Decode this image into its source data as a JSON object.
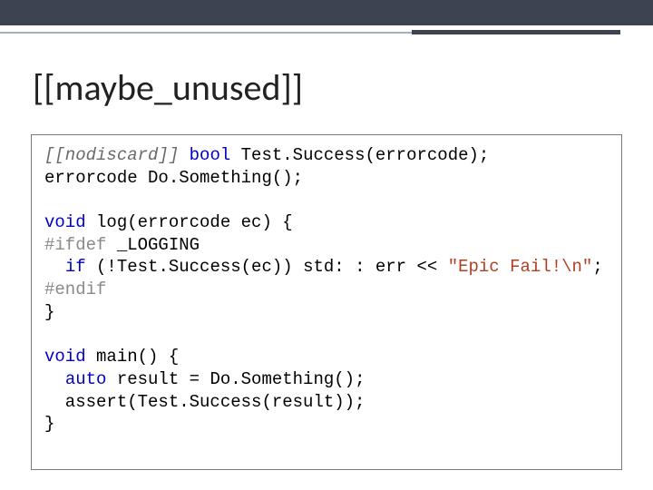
{
  "title": "[[maybe_unused]]",
  "code": {
    "l1": {
      "attr": "[[nodiscard]] ",
      "bool": "bool",
      "rest": " Test.Success(errorcode);"
    },
    "l2": "errorcode Do.Something();",
    "l3": "",
    "l4": {
      "void": "void",
      "rest": " log(errorcode ec) {"
    },
    "l5": {
      "pp": "#ifdef",
      "rest": " _LOGGING"
    },
    "l6": {
      "prefix": "  ",
      "if": "if",
      "mid": " (!Test.Success(ec)) std: : err << ",
      "str": "\"Epic Fail!\\n\"",
      "suffix": ";"
    },
    "l7": "#endif",
    "l8": "}",
    "l9": "",
    "l10": {
      "void": "void",
      "rest": " main() {"
    },
    "l11": {
      "prefix": "  ",
      "auto": "auto",
      "rest": " result = Do.Something();"
    },
    "l12": "  assert(Test.Success(result));",
    "l13": "}"
  }
}
